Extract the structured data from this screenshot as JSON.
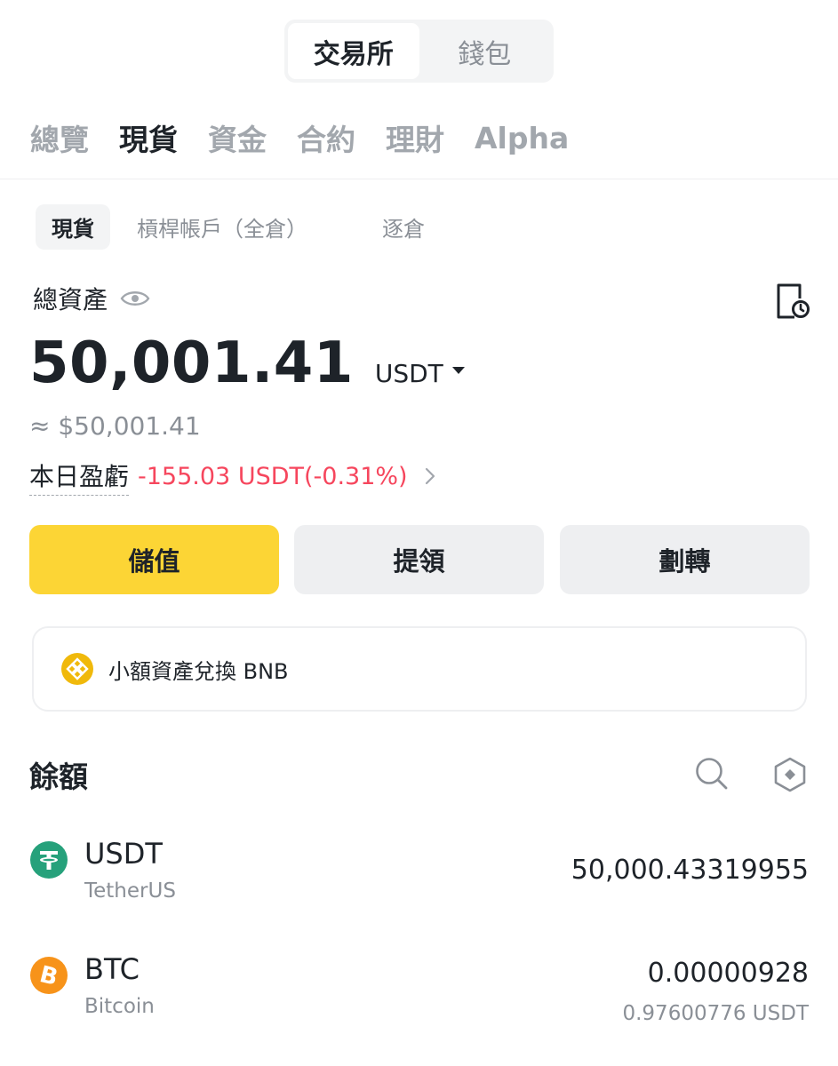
{
  "top_switch": {
    "exchange": "交易所",
    "wallet": "錢包"
  },
  "main_tabs": [
    {
      "label": "總覽",
      "active": false
    },
    {
      "label": "現貨",
      "active": true
    },
    {
      "label": "資金",
      "active": false
    },
    {
      "label": "合約",
      "active": false
    },
    {
      "label": "理財",
      "active": false
    },
    {
      "label": "Alpha",
      "active": false
    }
  ],
  "sub_tabs": [
    {
      "label": "現貨",
      "active": true
    },
    {
      "label": "槓桿帳戶（全倉）",
      "active": false
    },
    {
      "label": "逐倉",
      "active": false
    }
  ],
  "overview": {
    "total_label": "總資產",
    "balance": "50,001.41",
    "unit": "USDT",
    "approx": "≈ $50,001.41",
    "pnl_label": "本日盈虧",
    "pnl_value": "-155.03 USDT(-0.31%)"
  },
  "actions": {
    "deposit": "儲值",
    "withdraw": "提領",
    "transfer": "劃轉"
  },
  "convert": {
    "text": "小額資產兌換 BNB"
  },
  "balances": {
    "title": "餘額",
    "assets": [
      {
        "symbol": "USDT",
        "name": "TetherUS",
        "amount": "50,000.43319955",
        "value": ""
      },
      {
        "symbol": "BTC",
        "name": "Bitcoin",
        "amount": "0.00000928",
        "value": "0.97600776 USDT"
      }
    ]
  },
  "colors": {
    "accent": "#fcd535",
    "loss": "#f6465d",
    "usdt": "#26a17b",
    "btc": "#f7931a",
    "bnb": "#f0b90b"
  },
  "icons": [
    "eye-icon",
    "history-icon",
    "chevron-right-icon",
    "bnb-icon",
    "search-icon",
    "hide-small-icon",
    "usdt-icon",
    "btc-icon"
  ]
}
